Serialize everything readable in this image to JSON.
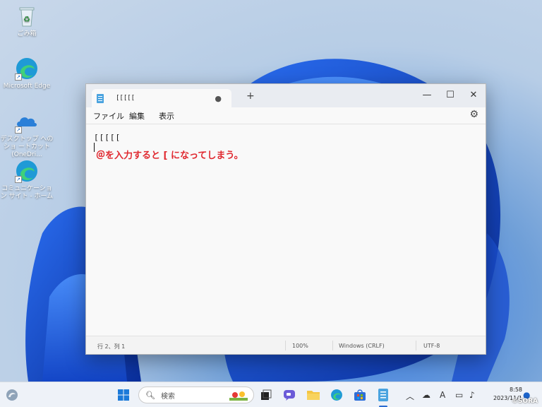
{
  "desktop": {
    "icons": [
      {
        "label": "ごみ箱",
        "icon": "recycle-bin-icon"
      },
      {
        "label": "Microsoft Edge",
        "icon": "edge-icon"
      },
      {
        "label": "デスクトップ へのショ ートカット (OneDri...",
        "icon": "onedrive-icon"
      },
      {
        "label": "コミュニケーション サイト - ホーム",
        "icon": "edge-icon"
      }
    ]
  },
  "notepad": {
    "tab_title": "[[[[[",
    "new_tab_label": "+",
    "menu": {
      "file": "ファイル",
      "edit": "編集",
      "view": "表示"
    },
    "editor": {
      "line1": "[[[[[",
      "annotation": "＠を入力すると [ になってしまう。"
    },
    "status": {
      "position": "行 2、列 1",
      "zoom": "100%",
      "line_ending": "Windows (CRLF)",
      "encoding": "UTF-8"
    }
  },
  "taskbar": {
    "search_label": "検索",
    "clock_time": "8:58",
    "clock_date": "2023/11/1"
  },
  "watermark": "©SORA",
  "colors": {
    "annotation": "#e0282f",
    "accent": "#2b6cd1"
  }
}
